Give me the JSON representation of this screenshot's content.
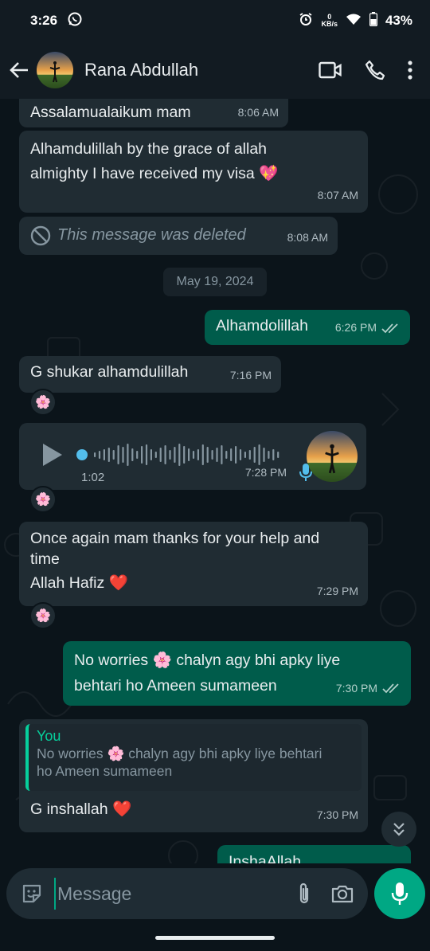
{
  "status": {
    "time": "3:26",
    "kbs_top": "0",
    "kbs_bottom": "KB/s",
    "battery": "43%"
  },
  "header": {
    "contact_name": "Rana Abdullah"
  },
  "messages": {
    "m1": {
      "text": "Assalamualaikum mam",
      "time": "8:06 AM"
    },
    "m2": {
      "line1": "Alhamdulillah by the grace of allah",
      "line2": "almighty I have received my visa",
      "emoji": "💖",
      "time": "8:07 AM"
    },
    "m3": {
      "text": "This message was deleted",
      "time": "8:08 AM"
    },
    "date_chip": "May 19, 2024",
    "m4": {
      "text": "Alhamdolillah",
      "time": "6:26 PM"
    },
    "m5": {
      "text": "G shukar alhamdulillah",
      "time": "7:16 PM",
      "reaction": "🌸"
    },
    "m6": {
      "duration": "1:02",
      "time": "7:28 PM",
      "reaction": "🌸"
    },
    "m7": {
      "line1": "Once again mam thanks for your help and",
      "line2": "time",
      "line3": "Allah Hafiz",
      "emoji": "❤️",
      "time": "7:29 PM",
      "reaction": "🌸"
    },
    "m8": {
      "line1a": "No worries",
      "flower": "🌸",
      "line1b": "chalyn agy bhi apky liye",
      "line2": "behtari ho Ameen sumameen",
      "time": "7:30 PM"
    },
    "m9": {
      "quote_author": "You",
      "quote_line1a": "No worries",
      "quote_flower": "🌸",
      "quote_line1b": "chalyn agy bhi apky liye behtari",
      "quote_line2": "ho Ameen sumameen",
      "text": "G inshallah",
      "emoji": "❤️",
      "time": "7:30 PM"
    },
    "m10": {
      "text": "InshaAllah"
    }
  },
  "composer": {
    "placeholder": "Message"
  },
  "colors": {
    "incoming": "#202c33",
    "outgoing": "#005c4b",
    "accent": "#00a884",
    "background": "#0b141a"
  }
}
